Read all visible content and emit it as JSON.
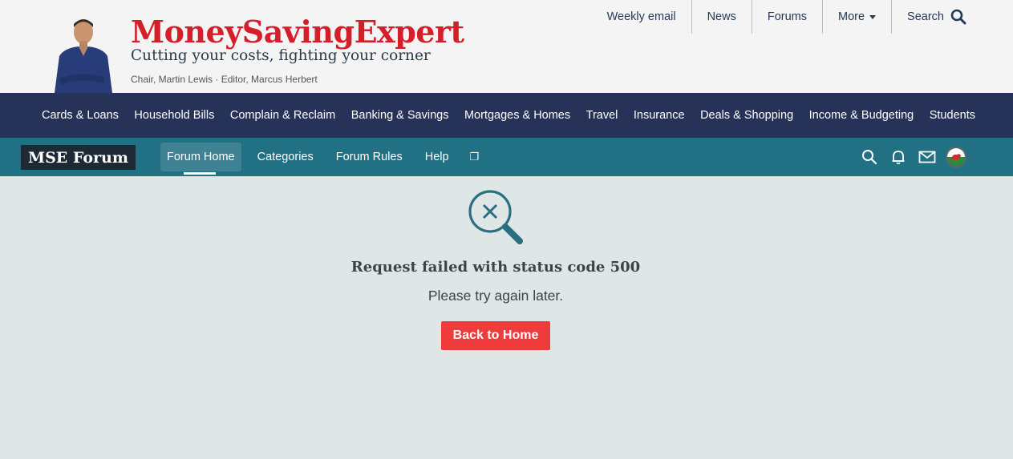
{
  "header": {
    "brand": "MoneySavingExpert",
    "tagline": "Cutting your costs, fighting your corner",
    "chair_line": "Chair, Martin Lewis · Editor, Marcus Herbert",
    "avatar_icon": "person-photo",
    "toplinks": [
      {
        "label": "Weekly email"
      },
      {
        "label": "News"
      },
      {
        "label": "Forums"
      },
      {
        "label": "More",
        "icon": "chevron-down-icon"
      },
      {
        "label": "Search",
        "icon": "search-icon"
      }
    ]
  },
  "catnav": {
    "items": [
      {
        "label": "Cards & Loans"
      },
      {
        "label": "Household Bills"
      },
      {
        "label": "Complain & Reclaim"
      },
      {
        "label": "Banking & Savings"
      },
      {
        "label": "Mortgages & Homes"
      },
      {
        "label": "Travel"
      },
      {
        "label": "Insurance"
      },
      {
        "label": "Deals & Shopping"
      },
      {
        "label": "Income & Budgeting"
      },
      {
        "label": "Students"
      }
    ]
  },
  "forum": {
    "logo": "MSE Forum",
    "nav": [
      {
        "label": "Forum Home",
        "active": true
      },
      {
        "label": "Categories"
      },
      {
        "label": "Forum Rules"
      },
      {
        "label": "Help"
      },
      {
        "label": "❐"
      }
    ],
    "icons": [
      "search-icon",
      "bell-icon",
      "mail-icon",
      "welsh-flag-icon"
    ]
  },
  "error": {
    "icon": "search-error-icon",
    "title": "Request failed with status code 500",
    "subtitle": "Please try again later.",
    "button": "Back to Home"
  },
  "colors": {
    "brand_red": "#d41e2a",
    "catnav_bg": "#273258",
    "forumbar_bg": "#227084",
    "page_bg": "#dfe6e6",
    "button_red": "#ef3b3b",
    "icon_teal": "#2a6f80"
  }
}
